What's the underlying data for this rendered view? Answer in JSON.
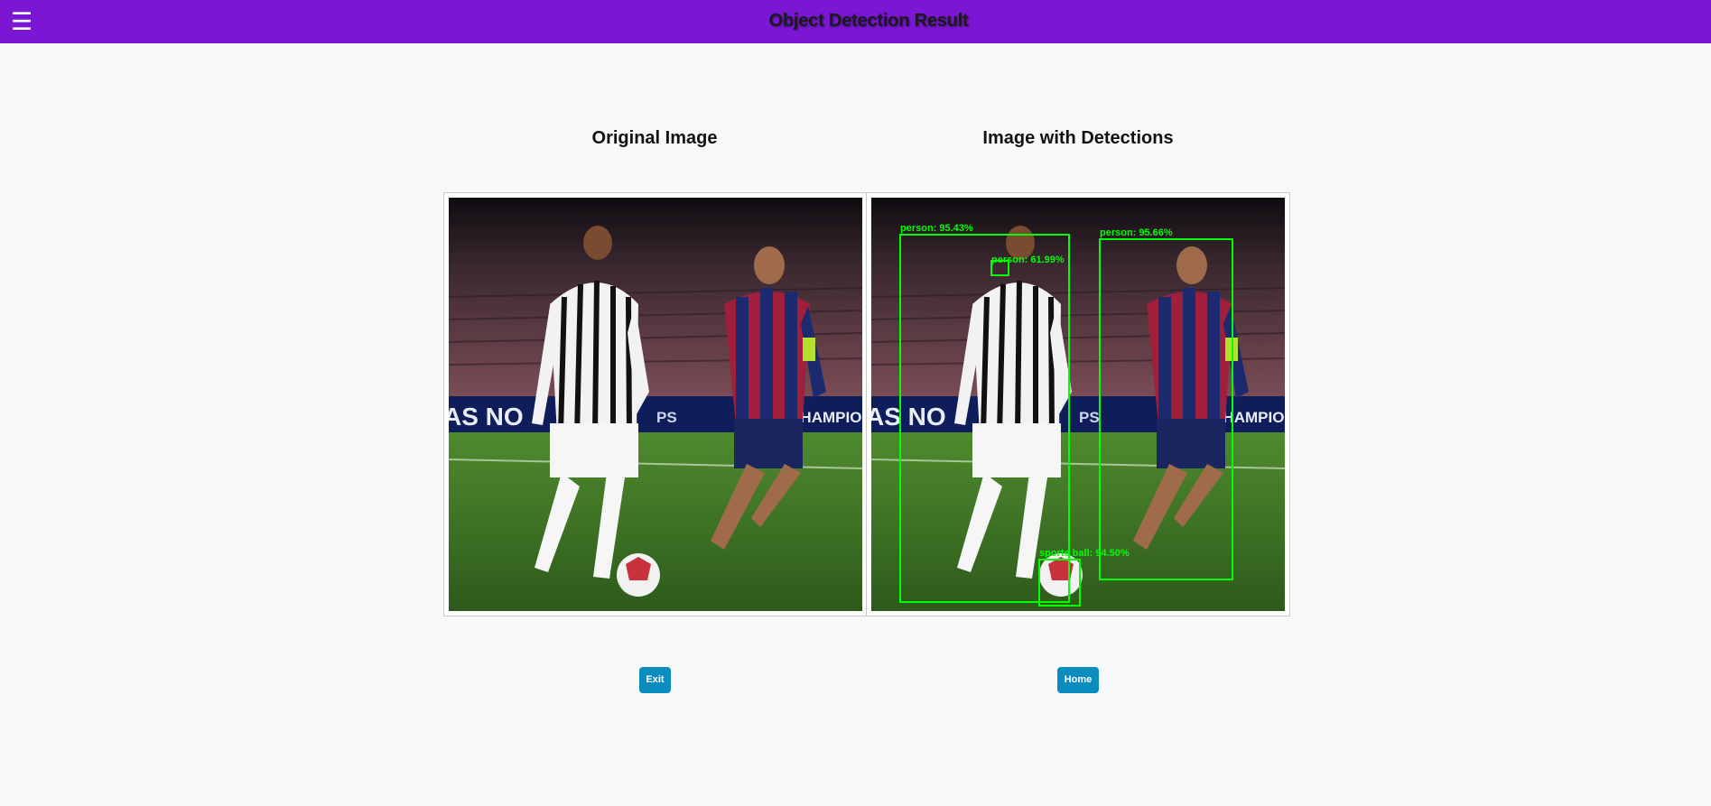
{
  "header": {
    "menu_icon": "hamburger-menu-icon",
    "menu_glyph": "☰",
    "title": "Object Detection Result",
    "background": "#7b16d5"
  },
  "columns": {
    "original_title": "Original Image",
    "detections_title": "Image with Detections"
  },
  "detections": [
    {
      "label": "person: 95.43%"
    },
    {
      "label": "person: 61.99%"
    },
    {
      "label": "person: 95.66%"
    },
    {
      "label": "sports ball: 94.50%"
    }
  ],
  "box_color": "#00ff00",
  "actions": {
    "exit_label": "Exit",
    "home_label": "Home",
    "button_color": "#0a8cbf"
  }
}
